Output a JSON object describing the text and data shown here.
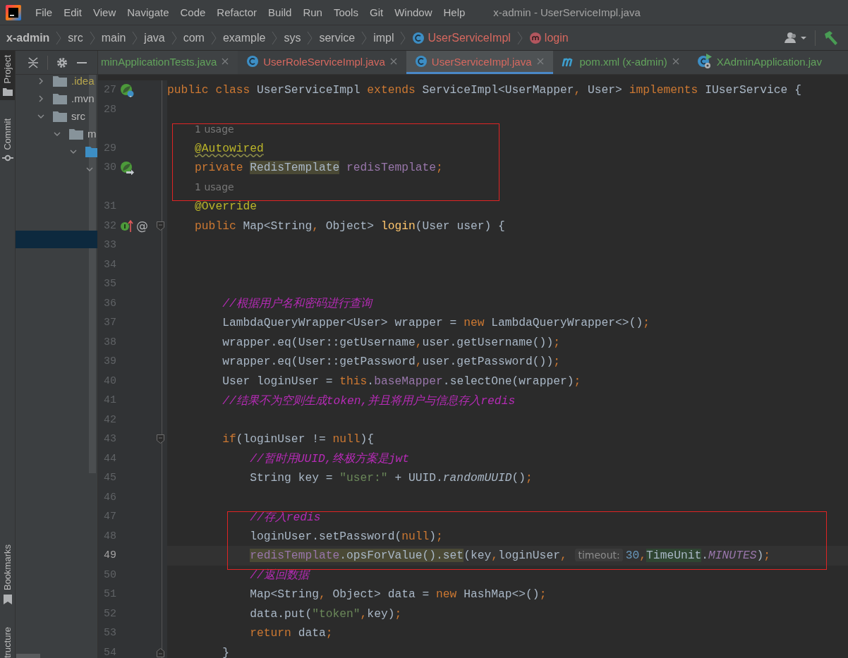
{
  "menu": [
    {
      "label": "File"
    },
    {
      "label": "Edit"
    },
    {
      "label": "View"
    },
    {
      "label": "Navigate"
    },
    {
      "label": "Code"
    },
    {
      "label": "Refactor"
    },
    {
      "label": "Build"
    },
    {
      "label": "Run"
    },
    {
      "label": "Tools"
    },
    {
      "label": "Git"
    },
    {
      "label": "Window"
    },
    {
      "label": "Help"
    }
  ],
  "window": {
    "title": "x-admin - UserServiceImpl.java"
  },
  "breadcrumbs": [
    {
      "label": "x-admin",
      "kind": "module",
      "color": "#bbbbbb"
    },
    {
      "label": "src",
      "kind": "folder",
      "color": "#bbbbbb"
    },
    {
      "label": "main",
      "kind": "folder",
      "color": "#bbbbbb"
    },
    {
      "label": "java",
      "kind": "folder",
      "color": "#bbbbbb"
    },
    {
      "label": "com",
      "kind": "folder",
      "color": "#bbbbbb"
    },
    {
      "label": "example",
      "kind": "folder",
      "color": "#bbbbbb"
    },
    {
      "label": "sys",
      "kind": "folder",
      "color": "#bbbbbb"
    },
    {
      "label": "service",
      "kind": "folder",
      "color": "#bbbbbb"
    },
    {
      "label": "impl",
      "kind": "folder",
      "color": "#bbbbbb"
    },
    {
      "label": "UserServiceImpl",
      "kind": "class",
      "color": "#d6685f"
    },
    {
      "label": "login",
      "kind": "method",
      "color": "#d6685f"
    }
  ],
  "side_stripe": {
    "top": [
      {
        "label": "Project",
        "kind": "project",
        "selected": true
      },
      {
        "label": "Commit",
        "kind": "commit",
        "selected": false
      }
    ],
    "bottom": [
      {
        "label": "Bookmarks",
        "kind": "bookmarks",
        "selected": false
      },
      {
        "label": "tructure",
        "kind": "structure",
        "selected": false
      }
    ]
  },
  "project_tree": [
    {
      "label": ".idea",
      "color": "#b5a44d",
      "expanded": false,
      "selected": false
    },
    {
      "label": ".mvn",
      "color": "#bbbbbb",
      "expanded": false,
      "selected": false
    },
    {
      "label": "src",
      "color": "#bbbbbb",
      "expanded": true,
      "selected": false,
      "children": [
        {
          "label": "m",
          "color": "#bbbbbb",
          "expanded": true,
          "selected": false,
          "children": [
            {
              "kind": "source",
              "expanded": true,
              "selected": false,
              "children": [
                {
                  "expanded": true,
                  "selected": false,
                  "children": [
                    {
                      "selected": false
                    },
                    {
                      "selected": false
                    },
                    {
                      "selected": false
                    },
                    {
                      "selected": true
                    }
                  ]
                }
              ]
            }
          ]
        }
      ]
    }
  ],
  "tabs": [
    {
      "label": "minApplicationTests.java",
      "kind": "none",
      "color": "#62a35c",
      "selected": false,
      "closable": true
    },
    {
      "label": "UserRoleServiceImpl.java",
      "kind": "class",
      "color": "#d6685f",
      "selected": false,
      "closable": true
    },
    {
      "label": "UserServiceImpl.java",
      "kind": "class",
      "color": "#d6685f",
      "selected": true,
      "closable": true
    },
    {
      "label": "pom.xml (x-admin)",
      "kind": "maven",
      "color": "#62a35c",
      "selected": false,
      "closable": true
    },
    {
      "label": "XAdminApplication.jav",
      "kind": "application",
      "color": "#62a35c",
      "selected": false,
      "closable": false
    }
  ],
  "editor": {
    "lines": [
      {
        "kind": "code",
        "number": "27",
        "marked": false,
        "current": false,
        "gutter_icons": [
          {
            "kind": "bean-class"
          }
        ],
        "tokens": [
          {
            "text": "public class ",
            "kind": "keyword"
          },
          {
            "text": "UserServiceImpl ",
            "kind": "plain"
          },
          {
            "text": "extends ",
            "kind": "keyword"
          },
          {
            "text": "ServiceImpl<UserMapper",
            "kind": "plain"
          },
          {
            "text": ", ",
            "kind": "keyword"
          },
          {
            "text": "User> ",
            "kind": "plain"
          },
          {
            "text": "implements ",
            "kind": "keyword"
          },
          {
            "text": "IUserService {",
            "kind": "plain"
          }
        ],
        "children": [
          {
            "kind": "code",
            "number": "28",
            "marked": false,
            "current": false
          },
          {
            "kind": "inlay",
            "text": "1 usage",
            "marked": true
          },
          {
            "kind": "code",
            "number": "29",
            "marked": true,
            "current": false,
            "tokens": [
              {
                "text": "@Autowired",
                "kind": "annotation-warning"
              }
            ]
          },
          {
            "kind": "code",
            "number": "30",
            "marked": true,
            "current": false,
            "gutter_icons": [
              {
                "kind": "bean-injected"
              }
            ],
            "tokens": [
              {
                "text": "private ",
                "kind": "keyword"
              },
              {
                "text": "RedisTemplate",
                "kind": "plain-usage"
              },
              {
                "text": " redisTemplate",
                "kind": "field"
              },
              {
                "text": ";",
                "kind": "keyword"
              }
            ]
          },
          {
            "kind": "inlay",
            "text": "1 usage",
            "marked": true
          },
          {
            "kind": "code",
            "number": "31",
            "marked": false,
            "current": false,
            "tokens": [
              {
                "text": "@Override",
                "kind": "annotation"
              }
            ]
          },
          {
            "kind": "code",
            "number": "32",
            "marked": false,
            "current": false,
            "gutter_icons": [
              {
                "kind": "implements"
              },
              {
                "kind": "symbol",
                "text": "@"
              },
              {
                "kind": "fold-start"
              }
            ],
            "tokens": [
              {
                "text": "public ",
                "kind": "keyword"
              },
              {
                "text": "Map<String",
                "kind": "plain"
              },
              {
                "text": ", ",
                "kind": "keyword"
              },
              {
                "text": "Object> ",
                "kind": "plain"
              },
              {
                "text": "login",
                "kind": "method"
              },
              {
                "text": "(User user) {",
                "kind": "plain"
              }
            ],
            "children": [
              {
                "kind": "code",
                "number": "33",
                "marked": false,
                "current": false
              },
              {
                "kind": "code",
                "number": "34",
                "marked": false,
                "current": false
              },
              {
                "kind": "code",
                "number": "35",
                "marked": false,
                "current": false
              },
              {
                "kind": "code",
                "number": "36",
                "marked": false,
                "current": false,
                "tokens": [
                  {
                    "text": "//根据用户名和密码进行查询",
                    "kind": "comment"
                  }
                ]
              },
              {
                "kind": "code",
                "number": "37",
                "marked": false,
                "current": false,
                "tokens": [
                  {
                    "text": "LambdaQueryWrapper<User> wrapper = ",
                    "kind": "plain"
                  },
                  {
                    "text": "new ",
                    "kind": "keyword"
                  },
                  {
                    "text": "LambdaQueryWrapper<>()",
                    "kind": "plain"
                  },
                  {
                    "text": ";",
                    "kind": "keyword"
                  }
                ]
              },
              {
                "kind": "code",
                "number": "38",
                "marked": false,
                "current": false,
                "tokens": [
                  {
                    "text": "wrapper.eq(User::getUsername",
                    "kind": "plain"
                  },
                  {
                    "text": ",",
                    "kind": "keyword"
                  },
                  {
                    "text": "user.getUsername())",
                    "kind": "plain"
                  },
                  {
                    "text": ";",
                    "kind": "keyword"
                  }
                ]
              },
              {
                "kind": "code",
                "number": "39",
                "marked": false,
                "current": false,
                "tokens": [
                  {
                    "text": "wrapper.eq(User::getPassword",
                    "kind": "plain"
                  },
                  {
                    "text": ",",
                    "kind": "keyword"
                  },
                  {
                    "text": "user.getPassword())",
                    "kind": "plain"
                  },
                  {
                    "text": ";",
                    "kind": "keyword"
                  }
                ]
              },
              {
                "kind": "code",
                "number": "40",
                "marked": false,
                "current": false,
                "tokens": [
                  {
                    "text": "User loginUser = ",
                    "kind": "plain"
                  },
                  {
                    "text": "this",
                    "kind": "keyword"
                  },
                  {
                    "text": ".",
                    "kind": "plain"
                  },
                  {
                    "text": "baseMapper",
                    "kind": "field"
                  },
                  {
                    "text": ".selectOne(wrapper)",
                    "kind": "plain"
                  },
                  {
                    "text": ";",
                    "kind": "keyword"
                  }
                ]
              },
              {
                "kind": "code",
                "number": "41",
                "marked": false,
                "current": false,
                "tokens": [
                  {
                    "text": "//结果不为空则生成token,并且将用户与信息存入redis",
                    "kind": "comment"
                  }
                ]
              },
              {
                "kind": "code",
                "number": "42",
                "marked": false,
                "current": false
              },
              {
                "kind": "code",
                "number": "43",
                "marked": false,
                "current": false,
                "gutter_icons": [
                  {
                    "kind": "fold-start"
                  }
                ],
                "tokens": [
                  {
                    "text": "if",
                    "kind": "keyword"
                  },
                  {
                    "text": "(loginUser != ",
                    "kind": "plain"
                  },
                  {
                    "text": "null",
                    "kind": "keyword"
                  },
                  {
                    "text": "){",
                    "kind": "plain"
                  }
                ],
                "children": [
                  {
                    "kind": "code",
                    "number": "44",
                    "marked": false,
                    "current": false,
                    "tokens": [
                      {
                        "text": "//暂时用UUID,终极方案是jwt",
                        "kind": "comment"
                      }
                    ]
                  },
                  {
                    "kind": "code",
                    "number": "45",
                    "marked": false,
                    "current": false,
                    "tokens": [
                      {
                        "text": "String key = ",
                        "kind": "plain"
                      },
                      {
                        "text": "\"user:\"",
                        "kind": "string"
                      },
                      {
                        "text": " + UUID.",
                        "kind": "plain"
                      },
                      {
                        "text": "randomUUID",
                        "kind": "static"
                      },
                      {
                        "text": "()",
                        "kind": "plain"
                      },
                      {
                        "text": ";",
                        "kind": "keyword"
                      }
                    ]
                  },
                  {
                    "kind": "code",
                    "number": "46",
                    "marked": false,
                    "current": false
                  },
                  {
                    "kind": "code",
                    "number": "47",
                    "marked": true,
                    "current": false,
                    "tokens": [
                      {
                        "text": "//存入redis",
                        "kind": "comment"
                      }
                    ]
                  },
                  {
                    "kind": "code",
                    "number": "48",
                    "marked": true,
                    "current": false,
                    "tokens": [
                      {
                        "text": "loginUser.setPassword(",
                        "kind": "plain"
                      },
                      {
                        "text": "null",
                        "kind": "keyword"
                      },
                      {
                        "text": ")",
                        "kind": "plain"
                      },
                      {
                        "text": ";",
                        "kind": "keyword"
                      }
                    ]
                  },
                  {
                    "kind": "code",
                    "number": "49",
                    "marked": true,
                    "current": true,
                    "tokens": [
                      {
                        "text": "redisTemplate",
                        "kind": "field-usage"
                      },
                      {
                        "text": ".opsForValue().set",
                        "kind": "plain-usage"
                      },
                      {
                        "text": "(key",
                        "kind": "plain"
                      },
                      {
                        "text": ",",
                        "kind": "keyword"
                      },
                      {
                        "text": "loginUser",
                        "kind": "plain"
                      },
                      {
                        "text": ",",
                        "kind": "keyword"
                      },
                      {
                        "text": "timeout:",
                        "kind": "hint"
                      },
                      {
                        "text": "30",
                        "kind": "number"
                      },
                      {
                        "text": ",",
                        "kind": "keyword"
                      },
                      {
                        "text": "TimeUnit",
                        "kind": "plain-write"
                      },
                      {
                        "text": ".",
                        "kind": "plain"
                      },
                      {
                        "text": "MINUTES",
                        "kind": "constant"
                      },
                      {
                        "text": ")",
                        "kind": "plain"
                      },
                      {
                        "text": ";",
                        "kind": "keyword"
                      }
                    ]
                  },
                  {
                    "kind": "code",
                    "number": "50",
                    "marked": false,
                    "current": false,
                    "tokens": [
                      {
                        "text": "//返回数据",
                        "kind": "comment"
                      }
                    ]
                  },
                  {
                    "kind": "code",
                    "number": "51",
                    "marked": false,
                    "current": false,
                    "tokens": [
                      {
                        "text": "Map<String",
                        "kind": "plain"
                      },
                      {
                        "text": ", ",
                        "kind": "keyword"
                      },
                      {
                        "text": "Object> data = ",
                        "kind": "plain"
                      },
                      {
                        "text": "new ",
                        "kind": "keyword"
                      },
                      {
                        "text": "HashMap<>()",
                        "kind": "plain"
                      },
                      {
                        "text": ";",
                        "kind": "keyword"
                      }
                    ]
                  },
                  {
                    "kind": "code",
                    "number": "52",
                    "marked": false,
                    "current": false,
                    "tokens": [
                      {
                        "text": "data.put(",
                        "kind": "plain"
                      },
                      {
                        "text": "\"token\"",
                        "kind": "string"
                      },
                      {
                        "text": ",",
                        "kind": "keyword"
                      },
                      {
                        "text": "key)",
                        "kind": "plain"
                      },
                      {
                        "text": ";",
                        "kind": "keyword"
                      }
                    ]
                  },
                  {
                    "kind": "code",
                    "number": "53",
                    "marked": false,
                    "current": false,
                    "tokens": [
                      {
                        "text": "return ",
                        "kind": "keyword"
                      },
                      {
                        "text": "data",
                        "kind": "plain"
                      },
                      {
                        "text": ";",
                        "kind": "keyword"
                      }
                    ]
                  }
                ]
              },
              {
                "kind": "code",
                "number": "54",
                "marked": false,
                "current": false,
                "gutter_icons": [
                  {
                    "kind": "fold-end"
                  }
                ],
                "tokens": [
                  {
                    "text": "}",
                    "kind": "plain"
                  }
                ]
              }
            ]
          }
        ]
      }
    ]
  }
}
